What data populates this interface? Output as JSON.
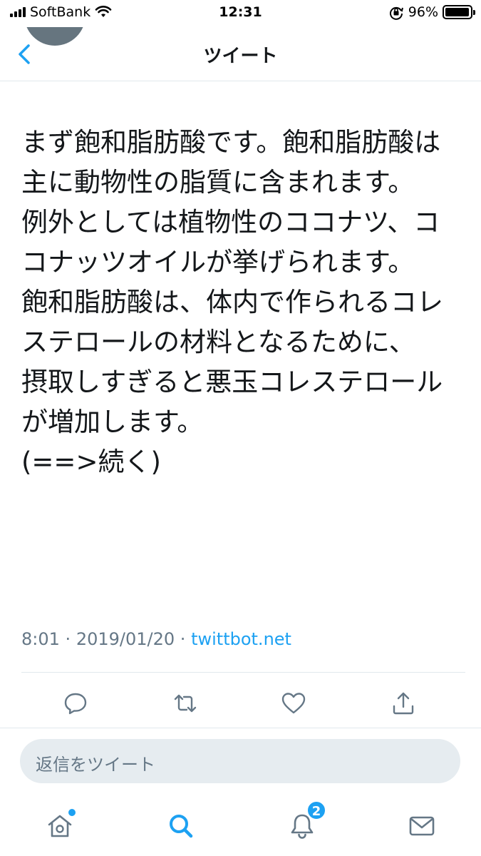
{
  "status_bar": {
    "carrier": "SoftBank",
    "time": "12:31",
    "battery_percent": "96%",
    "battery_level": 0.96
  },
  "nav": {
    "title": "ツイート"
  },
  "tweet": {
    "text": "まず飽和脂肪酸です。飽和脂肪酸は主に動物性の脂質に含まれます。\n例外としては植物性のココナツ、ココナッツオイルが挙げられます。\n飽和脂肪酸は、体内で作られるコレステロールの材料となるために、\n摂取しすぎると悪玉コレステロールが増加します。\n(==>続く)",
    "time": "8:01",
    "separator": "·",
    "date": "2019/01/20",
    "source": "twittbot.net"
  },
  "reply": {
    "placeholder": "返信をツイート"
  },
  "tabs": {
    "notifications_badge": "2"
  },
  "colors": {
    "accent": "#1da1f2",
    "muted": "#657786",
    "text": "#14171a",
    "reply_bg": "#e6ecf0"
  },
  "icons": {
    "back": "chevron-left-icon",
    "reply": "reply-icon",
    "retweet": "retweet-icon",
    "like": "heart-icon",
    "share": "share-icon",
    "home": "home-icon",
    "search": "search-icon",
    "notifications": "bell-icon",
    "messages": "envelope-icon"
  }
}
